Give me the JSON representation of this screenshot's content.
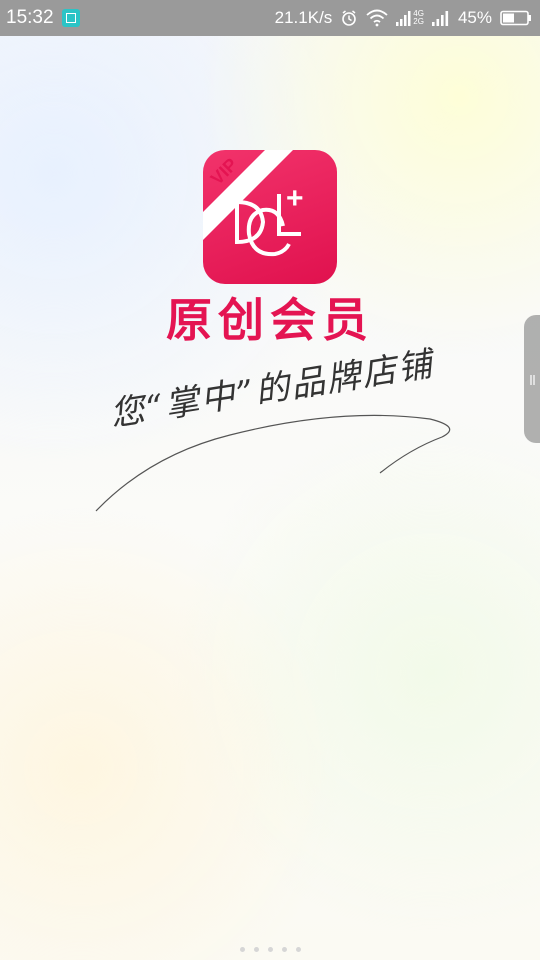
{
  "status_bar": {
    "time": "15:32",
    "net_speed": "21.1K/s",
    "network_type_top": "4G",
    "network_type_bottom": "2G",
    "battery_percent": "45%",
    "icons": [
      "screenshot-scan-icon",
      "alarm-icon",
      "wifi-icon",
      "signal-icon",
      "signal-icon-2",
      "battery-icon"
    ]
  },
  "logo": {
    "vip_label": "VIP",
    "monogram": "DC",
    "plus_mark": "+",
    "accent_color": "#e41452"
  },
  "brand": {
    "name": "原创会员"
  },
  "slogan": {
    "text": "您“掌中”的品牌店铺"
  },
  "pager": {
    "count": 5
  }
}
